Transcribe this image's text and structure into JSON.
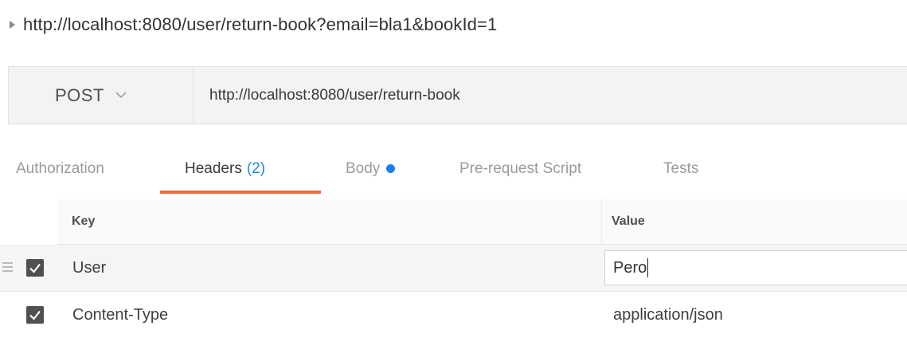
{
  "title": {
    "text": "http://localhost:8080/user/return-book?email=bla1&bookId=1"
  },
  "request": {
    "method": "POST",
    "url": "http://localhost:8080/user/return-book"
  },
  "tabs": [
    {
      "label": "Authorization"
    },
    {
      "label": "Headers",
      "count": "(2)"
    },
    {
      "label": "Body"
    },
    {
      "label": "Pre-request Script"
    },
    {
      "label": "Tests"
    }
  ],
  "headers_table": {
    "columns": {
      "key": "Key",
      "value": "Value"
    },
    "rows": [
      {
        "key": "User",
        "value": "Pero",
        "checked": true
      },
      {
        "key": "Content-Type",
        "value": "application/json",
        "checked": true
      }
    ]
  },
  "colors": {
    "active_tab_underline": "#f26b3a",
    "accent_blue": "#1e87f0"
  }
}
